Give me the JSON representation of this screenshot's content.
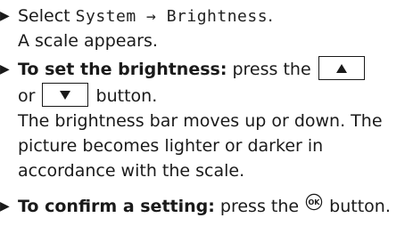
{
  "steps": [
    {
      "lines": [
        {
          "text_a": "Select ",
          "menu_path": "System → Brightness",
          "text_b": "."
        },
        {
          "text": "A scale appears."
        }
      ]
    },
    {
      "lines": [
        {
          "bold": "To set the brightness:",
          "text_a": " press the ",
          "button_icon": "up-triangle-button"
        },
        {
          "text_a": "or ",
          "button_icon": "down-triangle-button",
          "text_b": " button."
        },
        {
          "text": "The brightness bar moves up or down. The"
        },
        {
          "text": "picture becomes lighter or darker in"
        },
        {
          "text": "accordance with the scale."
        }
      ]
    },
    {
      "lines": [
        {
          "bold": "To confirm a setting:",
          "text_a": " press the ",
          "button_icon": "ok-button",
          "button_label": "OK",
          "text_b": " button."
        }
      ]
    }
  ],
  "bullet_icon": "right-triangle-bullet-icon"
}
